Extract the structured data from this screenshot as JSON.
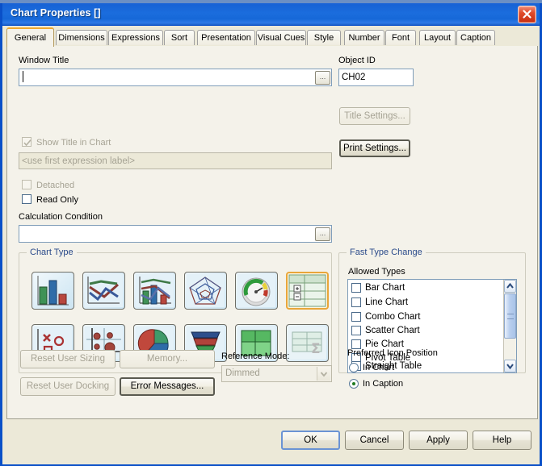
{
  "window": {
    "title": "Chart Properties []",
    "close_icon": "close-x-icon"
  },
  "tabs": [
    {
      "label": "General",
      "active": true
    },
    {
      "label": "Dimensions",
      "active": false
    },
    {
      "label": "Expressions",
      "active": false
    },
    {
      "label": "Sort",
      "active": false
    },
    {
      "label": "Presentation",
      "active": false
    },
    {
      "label": "Visual Cues",
      "active": false
    },
    {
      "label": "Style",
      "active": false
    },
    {
      "label": "Number",
      "active": false
    },
    {
      "label": "Font",
      "active": false
    },
    {
      "label": "Layout",
      "active": false
    },
    {
      "label": "Caption",
      "active": false
    }
  ],
  "general": {
    "window_title_label": "Window Title",
    "window_title_value": "",
    "window_title_ellipsis": "...",
    "show_title_label": "Show Title in Chart",
    "show_title_checked": true,
    "show_title_enabled": false,
    "title_expression_value": "<use first expression label>",
    "detached_label": "Detached",
    "detached_checked": false,
    "read_only_label": "Read Only",
    "read_only_checked": false,
    "calc_condition_label": "Calculation Condition",
    "calc_condition_value": "",
    "calc_condition_ellipsis": "...",
    "object_id_label": "Object ID",
    "object_id_value": "CH02",
    "title_settings_label": "Title Settings...",
    "print_settings_label": "Print Settings..."
  },
  "chart_type": {
    "group_label": "Chart Type",
    "selected_index": 5,
    "icons": [
      {
        "name": "bar-chart-icon",
        "title": "Bar Chart"
      },
      {
        "name": "line-chart-icon",
        "title": "Line Chart"
      },
      {
        "name": "combo-chart-icon",
        "title": "Combo Chart"
      },
      {
        "name": "radar-chart-icon",
        "title": "Radar Chart"
      },
      {
        "name": "gauge-chart-icon",
        "title": "Gauge Chart"
      },
      {
        "name": "pivot-table-icon",
        "title": "Pivot Table"
      },
      {
        "name": "scatter-chart-icon",
        "title": "Scatter Chart"
      },
      {
        "name": "bubble-chart-icon",
        "title": "Grid Chart"
      },
      {
        "name": "pie-chart-icon",
        "title": "Pie Chart"
      },
      {
        "name": "funnel-chart-icon",
        "title": "Funnel Chart"
      },
      {
        "name": "block-chart-icon",
        "title": "Block Chart"
      },
      {
        "name": "straight-table-icon",
        "title": "Straight Table"
      }
    ]
  },
  "fast_type_change": {
    "group_label": "Fast Type Change",
    "allowed_types_label": "Allowed Types",
    "items": [
      {
        "label": "Bar Chart",
        "checked": false
      },
      {
        "label": "Line Chart",
        "checked": false
      },
      {
        "label": "Combo Chart",
        "checked": false
      },
      {
        "label": "Scatter Chart",
        "checked": false
      },
      {
        "label": "Pie Chart",
        "checked": false
      },
      {
        "label": "Pivot Table",
        "checked": false
      },
      {
        "label": "Straight Table",
        "checked": false
      }
    ],
    "scroll_up_icon": "chevron-up-icon",
    "scroll_down_icon": "chevron-down-icon"
  },
  "footer_controls": {
    "reset_user_sizing_label": "Reset User Sizing",
    "reset_user_docking_label": "Reset User Docking",
    "memory_label": "Memory...",
    "error_messages_label": "Error Messages...",
    "reference_mode_label": "Reference Mode:",
    "reference_mode_value": "Dimmed",
    "reference_mode_arrow_icon": "chevron-down-icon"
  },
  "icon_position": {
    "label": "Preferred Icon Position",
    "options": [
      {
        "label": "In Chart",
        "selected": false
      },
      {
        "label": "In Caption",
        "selected": true
      }
    ]
  },
  "dialog_buttons": {
    "ok": "OK",
    "cancel": "Cancel",
    "apply": "Apply",
    "help": "Help"
  },
  "colors": {
    "titlebar": "#1763d6",
    "accent_tab": "#f0a92e",
    "panel_bg": "#f4f2ea",
    "dialog_bg": "#ece9d8",
    "group_title": "#2a4a8a",
    "close_button": "#c62d10"
  }
}
